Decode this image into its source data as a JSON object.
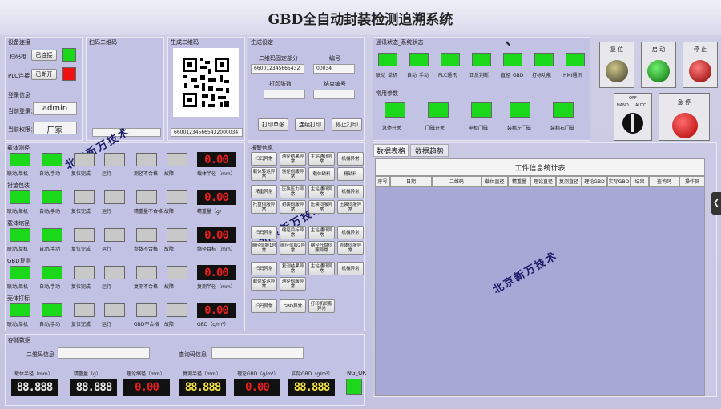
{
  "title": "GBD全自动封装检测追溯系统",
  "device": {
    "section": "设备连接",
    "scanner_label": "扫码枪",
    "scanner_status": "已连接",
    "plc_label": "PLC连接",
    "plc_status": "已断开"
  },
  "login": {
    "section": "登录信息",
    "user_label": "当前登录：",
    "user_value": "admin",
    "perm_label": "当前权限：",
    "perm_value": "厂家"
  },
  "scan": {
    "section": "扫码二维码",
    "value": ""
  },
  "qr": {
    "section": "生成二维码",
    "value": "660012345665432000034"
  },
  "gen": {
    "section": "生成设定",
    "fixed_label": "二维码固定部分",
    "fixed_value": "660012345665432",
    "num_label": "编号",
    "num_value": "00034",
    "print_label": "打印张数",
    "print_value": "",
    "end_label": "结束编号",
    "end_value": "",
    "btn_print_once": "打印单张",
    "btn_print_cont": "连续打印",
    "btn_stop": "停止打印"
  },
  "stations": [
    {
      "name": "载体测径",
      "labels": [
        "联动/单机",
        "自动/手动",
        "复位完成",
        "运行",
        "测径不合格",
        "故障"
      ],
      "meter_label": "载体半径（mm）",
      "value": "0.00"
    },
    {
      "name": "衬垫包装",
      "labels": [
        "联动/单机",
        "自动/手动",
        "复位完成",
        "运行",
        "精重量不合格",
        "故障"
      ],
      "meter_label": "精重量（g）",
      "value": "0.00"
    },
    {
      "name": "载体缩径",
      "labels": [
        "联动/单机",
        "自动/手动",
        "复位完成",
        "运行",
        "参数不合格",
        "故障"
      ],
      "meter_label": "缩径目标（mm）",
      "value": "0.00"
    },
    {
      "name": "GBD复测",
      "labels": [
        "联动/单机",
        "自动/手动",
        "复位完成",
        "运行",
        "复测不合格",
        "故障"
      ],
      "meter_label": "复测半径（mm）",
      "value": "0.00"
    },
    {
      "name": "壳体打标",
      "labels": [
        "联动/单机",
        "自动/手动",
        "复位完成",
        "运行",
        "GBD不合格",
        "故障"
      ],
      "meter_label": "GBD（g/m³）",
      "value": "0.00"
    }
  ],
  "alarms": {
    "section": "报警信息",
    "groups": [
      [
        "扫码异常",
        "测径结果异常",
        "主站通讯异常",
        "机械异常",
        "载体转运异常",
        "测径伺服异常",
        "载体缺料",
        "精缺料"
      ],
      [
        "精重异常",
        "压装压力异常",
        "主站通讯异常",
        "机械异常",
        "托盘伺服异常",
        "封装伺服异常",
        "压装伺服异常",
        "压装伺服异常"
      ],
      [
        "扫码异常",
        "缩径目标异常",
        "主站通讯异常",
        "机械异常",
        "缩径伺服1异常",
        "缩径伺服2异常",
        "缩径托盘伺服异常",
        "壳体伺服异常"
      ],
      [
        "扫码异常",
        "复测结果异常",
        "主站通讯异常",
        "机械异常",
        "载体转运异常",
        "测径伺服异常"
      ],
      [
        "扫码异常",
        "GBD异常",
        "打印机伺服异常"
      ]
    ]
  },
  "comm": {
    "section": "通讯状态_系统状态",
    "items": [
      "联动_单机",
      "自动_手动",
      "PLC通讯",
      "正反判断",
      "直径_GBD",
      "打标功能",
      "HMI通讯"
    ]
  },
  "params": {
    "section": "常用参数",
    "items": [
      "急停开关",
      "门磁开关",
      "电柜门磁",
      "装精左门磁",
      "装精右门磁"
    ]
  },
  "hw": {
    "reset": "复 位",
    "start": "启 动",
    "stop": "停 止",
    "off": "OFF",
    "hand": "HAND",
    "auto": "AUTO",
    "estop": "急 停"
  },
  "tabs": [
    "数据表格",
    "数据趋势"
  ],
  "table": {
    "title": "工件信息统计表",
    "columns": [
      "序号",
      "日期",
      "二维码",
      "载体直径",
      "精重量",
      "理论直径",
      "复测直径",
      "理论GBD",
      "实际GBD",
      "结果",
      "查询码",
      "操作员"
    ]
  },
  "storage": {
    "section": "存储数据",
    "qr_label": "二维码信息",
    "qr_value": "",
    "query_label": "查询码信息",
    "query_value": ""
  },
  "bottom": {
    "meters": [
      {
        "label": "载体半径（mm）",
        "value": "88.888",
        "color": "#e8e8e8"
      },
      {
        "label": "精重量（g）",
        "value": "88.888",
        "color": "#e8e8e8"
      },
      {
        "label": "理论缩径（mm）",
        "value": "0.00",
        "color": "#e61e1e"
      },
      {
        "label": "复测半径（mm）",
        "value": "88.888",
        "color": "#f0e040"
      },
      {
        "label": "理论GBD（g/m³）",
        "value": "0.00",
        "color": "#e61e1e"
      },
      {
        "label": "实际GBD（g/m³）",
        "value": "88.888",
        "color": "#f0e040"
      }
    ],
    "ok_label": "NG_OK"
  },
  "watermark": "北京新万技术"
}
